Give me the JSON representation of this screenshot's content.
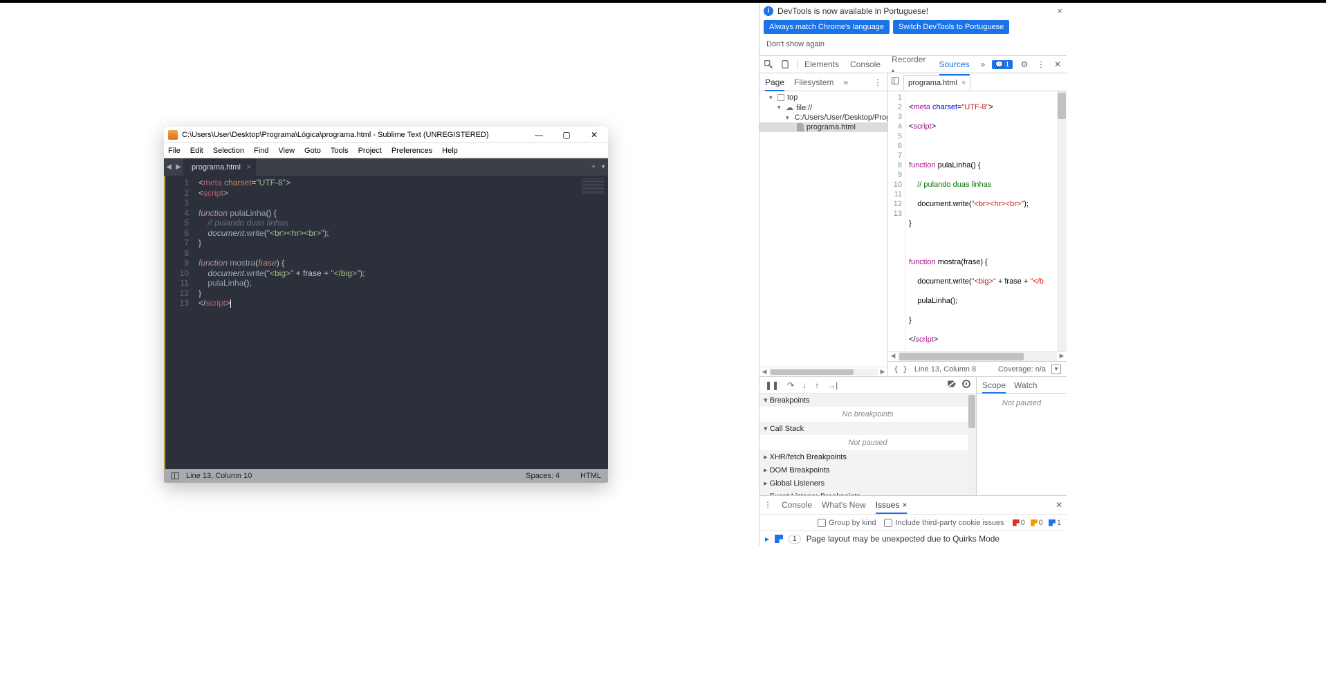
{
  "sublime": {
    "title": "C:\\Users\\User\\Desktop\\Programa\\Lógica\\programa.html - Sublime Text (UNREGISTERED)",
    "menu": [
      "File",
      "Edit",
      "Selection",
      "Find",
      "View",
      "Goto",
      "Tools",
      "Project",
      "Preferences",
      "Help"
    ],
    "tab": {
      "label": "programa.html"
    },
    "status": {
      "pos": "Line 13, Column 10",
      "spaces": "Spaces: 4",
      "lang": "HTML"
    },
    "code_lines": 13
  },
  "devtools": {
    "banner": "DevTools is now available in Portuguese!",
    "banner_buttons": {
      "match": "Always match Chrome's language",
      "switch": "Switch DevTools to Portuguese",
      "dont": "Don't show again"
    },
    "main_tabs": [
      "Elements",
      "Console",
      "Recorder",
      "Sources"
    ],
    "main_active": "Sources",
    "msg_count": "1",
    "nav": {
      "tabs": [
        "Page",
        "Filesystem"
      ],
      "active": "Page",
      "tree": {
        "top": "top",
        "file": "file://",
        "folder": "C:/Users/User/Desktop/Progra...",
        "leaf": "programa.html"
      }
    },
    "src": {
      "filetab": "programa.html",
      "status_pos": "Line 13, Column 8",
      "coverage": "Coverage: n/a"
    },
    "dbg": {
      "sections": [
        "Breakpoints",
        "Call Stack",
        "XHR/fetch Breakpoints",
        "DOM Breakpoints",
        "Global Listeners",
        "Event Listener Breakpoints"
      ],
      "no_breakpoints": "No breakpoints",
      "not_paused": "Not paused",
      "right_tabs": [
        "Scope",
        "Watch"
      ],
      "right_active": "Scope"
    },
    "drawer": {
      "tabs": [
        "Console",
        "What's New",
        "Issues"
      ],
      "active": "Issues",
      "group": "Group by kind",
      "include": "Include third-party cookie issues",
      "counts": {
        "r": "0",
        "y": "0",
        "b": "1"
      },
      "issue_text": "Page layout may be unexpected due to Quirks Mode",
      "issue_count": "1"
    }
  }
}
